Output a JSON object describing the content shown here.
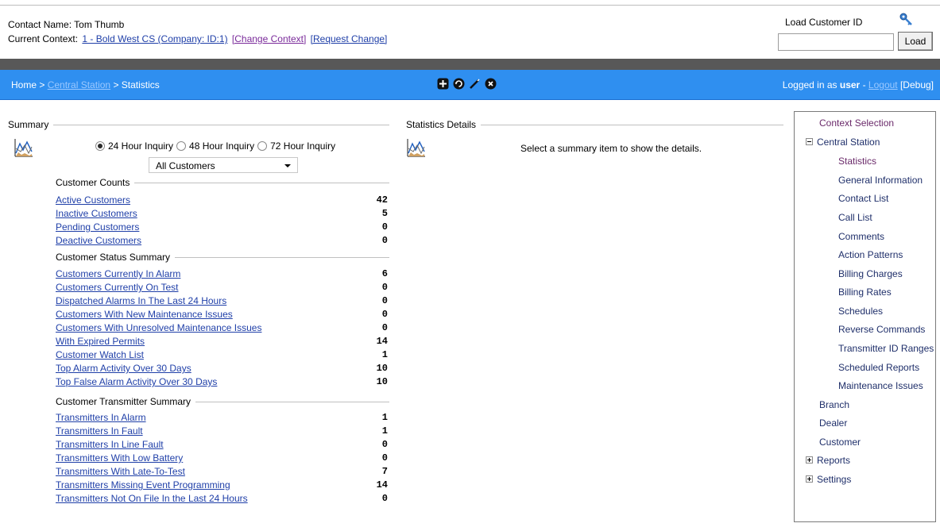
{
  "header": {
    "contact_name": "Contact Name: Tom Thumb",
    "context_label": "Current Context:",
    "context_link": "1 - Bold West CS (Company: ID:1)",
    "change_context": "[Change Context]",
    "request_change": "[Request Change]",
    "load_label": "Load Customer ID",
    "load_input_value": "",
    "load_button": "Load"
  },
  "navbar": {
    "crumb_home": "Home >",
    "crumb_central": "Central Station",
    "crumb_current": "> Statistics",
    "logged_prefix": "Logged in as",
    "user": "user",
    "dash": "-",
    "logout": "Logout",
    "debug": "[Debug]",
    "tools": [
      "add-icon",
      "refresh-icon",
      "edit-icon",
      "close-icon"
    ],
    "bar_color": "#2f8ff0"
  },
  "summary": {
    "title": "Summary",
    "radios": [
      {
        "label": "24 Hour Inquiry",
        "selected": true
      },
      {
        "label": "48 Hour Inquiry",
        "selected": false
      },
      {
        "label": "72 Hour Inquiry",
        "selected": false
      }
    ],
    "customer_filter": "All Customers",
    "groups": [
      {
        "title": "Customer Counts",
        "rows": [
          {
            "label": "Active Customers",
            "value": "42"
          },
          {
            "label": "Inactive Customers",
            "value": "5"
          },
          {
            "label": "Pending Customers",
            "value": "0"
          },
          {
            "label": "Deactive Customers",
            "value": "0"
          }
        ]
      },
      {
        "title": "Customer Status Summary",
        "rows": [
          {
            "label": "Customers Currently In Alarm",
            "value": "6"
          },
          {
            "label": "Customers Currently On Test",
            "value": "0"
          },
          {
            "label": "Dispatched Alarms In The Last 24 Hours",
            "value": "0"
          },
          {
            "label": "Customers With New Maintenance Issues",
            "value": "0"
          },
          {
            "label": "Customers With Unresolved Maintenance Issues",
            "value": "0"
          },
          {
            "label": "With Expired Permits",
            "value": "14"
          },
          {
            "label": "Customer Watch List",
            "value": "1"
          },
          {
            "label": "Top Alarm Activity Over 30 Days",
            "value": "10"
          },
          {
            "label": "Top False Alarm Activity Over 30 Days",
            "value": "10"
          }
        ]
      },
      {
        "title": "Customer Transmitter Summary",
        "rows": [
          {
            "label": "Transmitters In Alarm",
            "value": "1"
          },
          {
            "label": "Transmitters In Fault",
            "value": "1"
          },
          {
            "label": "Transmitters In Line Fault",
            "value": "0"
          },
          {
            "label": "Transmitters With Low Battery",
            "value": "0"
          },
          {
            "label": "Transmitters With Late-To-Test",
            "value": "7"
          },
          {
            "label": "Transmitters Missing Event Programming",
            "value": "14"
          },
          {
            "label": "Transmitters Not On File In the Last 24 Hours",
            "value": "0"
          }
        ]
      }
    ]
  },
  "details": {
    "title": "Statistics Details",
    "message": "Select a summary item to show the details."
  },
  "sidebar": {
    "context_selection": "Context Selection",
    "central_station": "Central Station",
    "central_items": [
      "Statistics",
      "General Information",
      "Contact List",
      "Call List",
      "Comments",
      "Action Patterns",
      "Billing Charges",
      "Billing Rates",
      "Schedules",
      "Reverse Commands",
      "Transmitter ID Ranges",
      "Scheduled Reports",
      "Maintenance Issues"
    ],
    "branch": "Branch",
    "dealer": "Dealer",
    "customer": "Customer",
    "reports": "Reports",
    "settings": "Settings"
  }
}
